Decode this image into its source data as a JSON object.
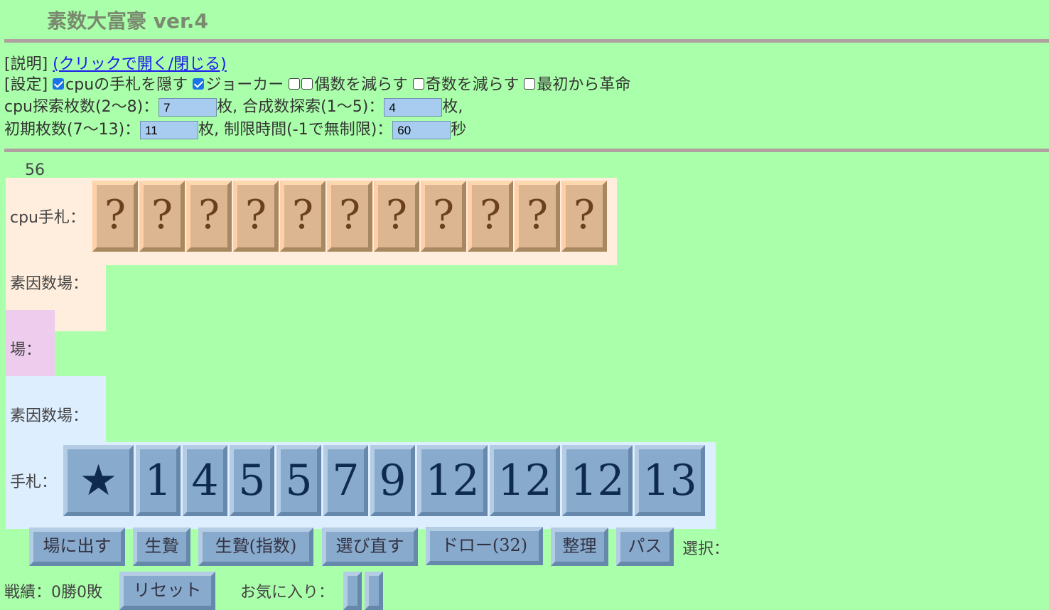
{
  "title": "素数大富豪 ver.4",
  "explain": {
    "label": "[説明]",
    "link": "(クリックで開く/閉じる)"
  },
  "settings": {
    "label": "[設定]",
    "hide_cpu": "cpuの手札を隠す",
    "joker": "ジョーカー",
    "reduce_even": "偶数を減らす",
    "reduce_odd": "奇数を減らす",
    "revolution": "最初から革命",
    "cpu_search_label": "cpu探索枚数(2〜8)：",
    "cpu_search_value": "7",
    "composite_label": "合成数探索(1〜5)：",
    "composite_value": "4",
    "initial_label": "初期枚数(7〜13)：",
    "initial_value": "11",
    "time_label": "制限時間(-1で無制限)：",
    "time_value": "60",
    "unit_mai": "枚,",
    "unit_mai_last": "枚,",
    "unit_byo": "秒",
    "checked": {
      "hide_cpu": true,
      "joker": true,
      "reduce_even_a": false,
      "reduce_even_b": false,
      "reduce_odd": false,
      "revolution": false
    }
  },
  "timer": "56",
  "cpu_hand": {
    "label": "cpu手札：",
    "cards": [
      "?",
      "?",
      "?",
      "?",
      "?",
      "?",
      "?",
      "?",
      "?",
      "?",
      "?"
    ]
  },
  "cpu_factor_label": "素因数場：",
  "field_label": "場：",
  "player_factor_label": "素因数場：",
  "player_hand": {
    "label": "手札：",
    "cards": [
      "★",
      "1",
      "4",
      "5",
      "5",
      "7",
      "9",
      "12",
      "12",
      "12",
      "13"
    ]
  },
  "buttons": {
    "play": "場に出す",
    "sacrifice": "生贄",
    "sacrifice_exp": "生贄(指数)",
    "reselect": "選び直す",
    "draw": "ドロー(32)",
    "sort": "整理",
    "pass": "パス"
  },
  "selection_label": "選択：",
  "record": {
    "label": "戦績：0勝0敗",
    "reset": "リセット"
  },
  "favorites_label": "お気に入り：",
  "colors": {
    "background": "#aaffaa",
    "cpu_zone": "#ffeedd",
    "field_zone": "#eeccee",
    "player_zone": "#ddeeff",
    "card_player": "#88aacc",
    "card_cpu": "#dcb690"
  }
}
